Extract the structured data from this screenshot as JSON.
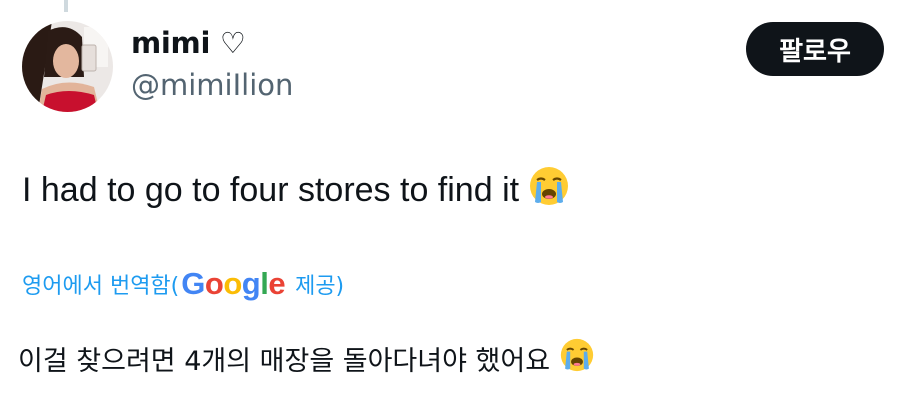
{
  "author": {
    "display_name": "mimi ♡",
    "handle": "@mimiIlion",
    "avatar_icon": "profile-photo"
  },
  "follow_button": {
    "label": "팔로우"
  },
  "tweet": {
    "text": "I had to go to four stores to find it",
    "emoji_icon": "loudly-crying-face-emoji"
  },
  "translation": {
    "label": "영어에서 번역함(",
    "provider": "Google",
    "provided_label": "제공)",
    "text": "이걸 찾으려면 4개의 매장을 돌아다녀야 했어요",
    "emoji_icon": "loudly-crying-face-emoji"
  },
  "colors": {
    "link_blue": "#1d9bf0",
    "secondary_text": "#536471",
    "button_bg": "#0f1419"
  }
}
